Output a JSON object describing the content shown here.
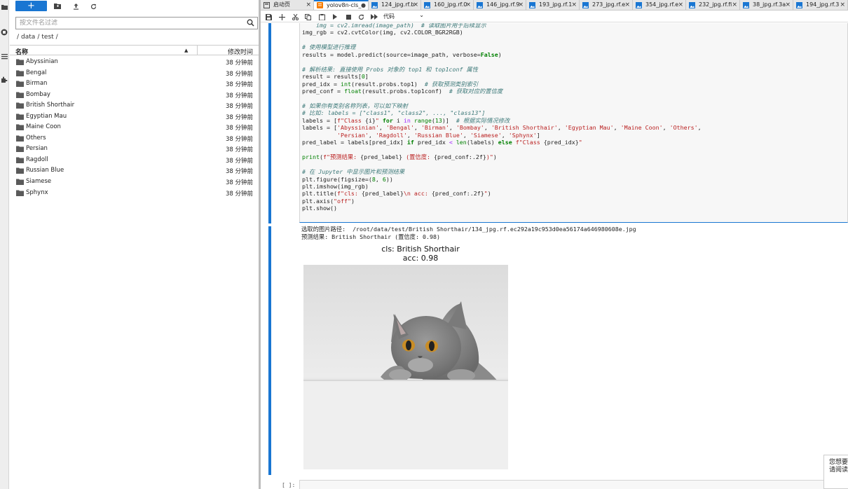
{
  "file_browser": {
    "new_label": "+",
    "filter_placeholder": "按文件名过滤",
    "breadcrumb": [
      "/",
      "data",
      "/",
      "test",
      "/"
    ],
    "header_name": "名称",
    "header_sort": "▲",
    "header_time": "修改时间",
    "items": [
      {
        "name": "Abyssinian",
        "time": "38 分钟前"
      },
      {
        "name": "Bengal",
        "time": "38 分钟前"
      },
      {
        "name": "Birman",
        "time": "38 分钟前"
      },
      {
        "name": "Bombay",
        "time": "38 分钟前"
      },
      {
        "name": "British Shorthair",
        "time": "38 分钟前"
      },
      {
        "name": "Egyptian Mau",
        "time": "38 分钟前"
      },
      {
        "name": "Maine Coon",
        "time": "38 分钟前"
      },
      {
        "name": "Others",
        "time": "38 分钟前"
      },
      {
        "name": "Persian",
        "time": "38 分钟前"
      },
      {
        "name": "Ragdoll",
        "time": "38 分钟前"
      },
      {
        "name": "Russian Blue",
        "time": "38 分钟前"
      },
      {
        "name": "Siamese",
        "time": "38 分钟前"
      },
      {
        "name": "Sphynx",
        "time": "38 分钟前"
      }
    ]
  },
  "tabs": [
    {
      "label": "启动页",
      "close": "×",
      "icon": "launcher-icon"
    },
    {
      "label": "yolov8n-cls_",
      "close": "●",
      "icon": "notebook-icon",
      "active": true
    },
    {
      "label": "124_jpg.rf.b",
      "close": "×",
      "icon": "image-icon"
    },
    {
      "label": "160_jpg.rf.0",
      "close": "×",
      "icon": "image-icon"
    },
    {
      "label": "146_jpg.rf.9",
      "close": "×",
      "icon": "image-icon"
    },
    {
      "label": "193_jpg.rf.1",
      "close": "×",
      "icon": "image-icon"
    },
    {
      "label": "273_jpg.rf.e",
      "close": "×",
      "icon": "image-icon"
    },
    {
      "label": "354_jpg.rf.e",
      "close": "×",
      "icon": "image-icon"
    },
    {
      "label": "232_jpg.rf.fi",
      "close": "×",
      "icon": "image-icon"
    },
    {
      "label": "38_jpg.rf.3a",
      "close": "×",
      "icon": "image-icon"
    },
    {
      "label": "194_jpg.rf.3",
      "close": "×",
      "icon": "image-icon"
    }
  ],
  "notebook_toolbar": {
    "cell_type": "代码",
    "cell_type_arrow": "⌄"
  },
  "output": {
    "line1": "选取的图片路径:  /root/data/test/British Shorthair/134_jpg.rf.ec292a19c953d0ea56174a646980608e.jpg",
    "line2": "预测结果: British Shorthair (置信度: 0.98)",
    "plot_title_1": "cls: British Shorthair",
    "plot_title_2": "acc: 0.98"
  },
  "empty_cell_prompt": "[ ]:",
  "toast": {
    "line1": "您想要",
    "line2": "请阅读"
  },
  "colors": {
    "accent": "#1976d2",
    "comment": "#3e7a7a",
    "keyword": "#008000",
    "string": "#ba2121"
  }
}
